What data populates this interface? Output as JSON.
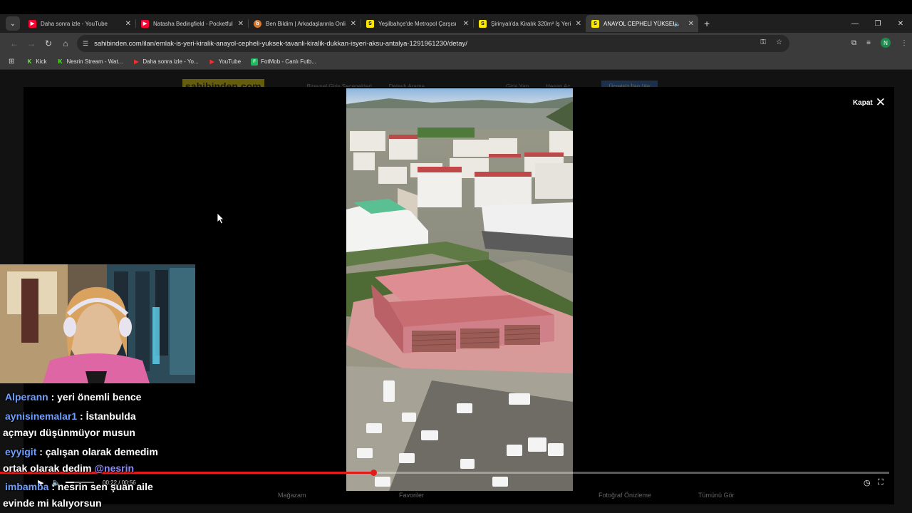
{
  "browser": {
    "tabs": [
      {
        "title": "Daha sonra izle - YouTube",
        "favicon": "youtube-icon",
        "active": false
      },
      {
        "title": "Natasha Bedingfield - Pocketful",
        "favicon": "youtube-icon",
        "active": false
      },
      {
        "title": "Ben Bildim | Arkadaşlarınla Onli",
        "favicon": "benbildim-icon",
        "active": false
      },
      {
        "title": "Yeşilbahçe'de Metropol Çarşısı",
        "favicon": "sahibinden-icon",
        "active": false
      },
      {
        "title": "Şirinyalı'da Kiralık 320m² İş Yeri",
        "favicon": "sahibinden-icon",
        "active": false
      },
      {
        "title": "ANAYOL CEPHELİ YÜKSEK T",
        "favicon": "sahibinden-icon",
        "active": true,
        "audio": true
      }
    ],
    "url": "sahibinden.com/ilan/emlak-is-yeri-kiralik-anayol-cepheli-yuksek-tavanli-kiralik-dukkan-isyeri-aksu-antalya-1291961230/detay/",
    "profile_initial": "N",
    "bookmarks": [
      {
        "label": "Kick",
        "icon": "kick-icon"
      },
      {
        "label": "Nesrin Stream - Wat...",
        "icon": "kick-icon"
      },
      {
        "label": "Daha sonra izle - Yo...",
        "icon": "youtube-icon"
      },
      {
        "label": "YouTube",
        "icon": "youtube-icon"
      },
      {
        "label": "FotMob - Canlı Futb...",
        "icon": "fotmob-icon"
      }
    ]
  },
  "page": {
    "site_logo": "sahibinden.com",
    "close_label": "Kapat",
    "background_links": [
      "Bireysel Giriş Seçenekleri",
      "Detaylı Arama",
      "Giriş Yap",
      "Hesap Aç"
    ],
    "post_ad_label": "Ücretsiz İlan Ver",
    "footer_hints": [
      "Mağazam",
      "Favoriler",
      "Fotoğraf Önizleme",
      "Tümünü Gör"
    ]
  },
  "video": {
    "current_time": "00:22",
    "duration": "00:56",
    "progress": 0.42
  },
  "chat": [
    {
      "user": "Alperann",
      "text": " : yeri önemli bence",
      "cont": ""
    },
    {
      "user": "aynisinemalar1",
      "text": " : İstanbulda",
      "cont": "açmayı düşünmüyor musun"
    },
    {
      "user": "eyyigit",
      "text": " : çalışan olarak demedim",
      "cont": "ortak olarak dedim ",
      "mention": "@nesrin"
    },
    {
      "user": "imbamba",
      "text": " : nesrin sen şuan aile",
      "cont": "evinde mi kalıyorsun"
    }
  ]
}
